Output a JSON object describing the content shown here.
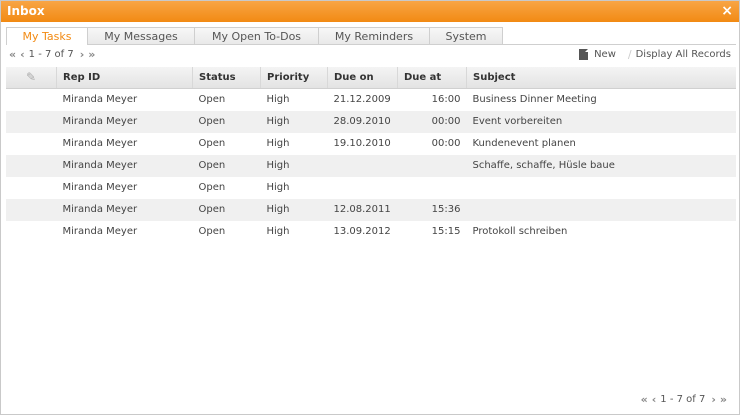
{
  "window": {
    "title": "Inbox",
    "close_glyph": "×"
  },
  "tabs": [
    {
      "label": "My Tasks",
      "active": true
    },
    {
      "label": "My Messages",
      "active": false
    },
    {
      "label": "My Open To-Dos",
      "active": false
    },
    {
      "label": "My Reminders",
      "active": false
    },
    {
      "label": "System",
      "active": false
    }
  ],
  "pager": {
    "range_text_top": "1 - 7 of 7",
    "range_text_bottom": "1 - 7 of 7"
  },
  "actions": {
    "new_label": "New",
    "display_all_label": "Display All Records"
  },
  "table": {
    "columns": [
      "Rep ID",
      "Status",
      "Priority",
      "Due on",
      "Due at",
      "Subject"
    ],
    "rows": [
      {
        "rep": "Miranda Meyer",
        "status": "Open",
        "priority": "High",
        "due_on": "21.12.2009",
        "due_at": "16:00",
        "subject": "Business Dinner Meeting"
      },
      {
        "rep": "Miranda Meyer",
        "status": "Open",
        "priority": "High",
        "due_on": "28.09.2010",
        "due_at": "00:00",
        "subject": "Event vorbereiten"
      },
      {
        "rep": "Miranda Meyer",
        "status": "Open",
        "priority": "High",
        "due_on": "19.10.2010",
        "due_at": "00:00",
        "subject": "Kundenevent planen"
      },
      {
        "rep": "Miranda Meyer",
        "status": "Open",
        "priority": "High",
        "due_on": "",
        "due_at": "",
        "subject": "Schaffe, schaffe, Hüsle baue"
      },
      {
        "rep": "Miranda Meyer",
        "status": "Open",
        "priority": "High",
        "due_on": "",
        "due_at": "",
        "subject": ""
      },
      {
        "rep": "Miranda Meyer",
        "status": "Open",
        "priority": "High",
        "due_on": "12.08.2011",
        "due_at": "15:36",
        "subject": ""
      },
      {
        "rep": "Miranda Meyer",
        "status": "Open",
        "priority": "High",
        "due_on": "13.09.2012",
        "due_at": "15:15",
        "subject": "Protokoll schreiben"
      }
    ]
  },
  "colors": {
    "accent": "#f28a13",
    "titlebar": "#f59a2c",
    "row_alt": "#f0f0f0"
  }
}
